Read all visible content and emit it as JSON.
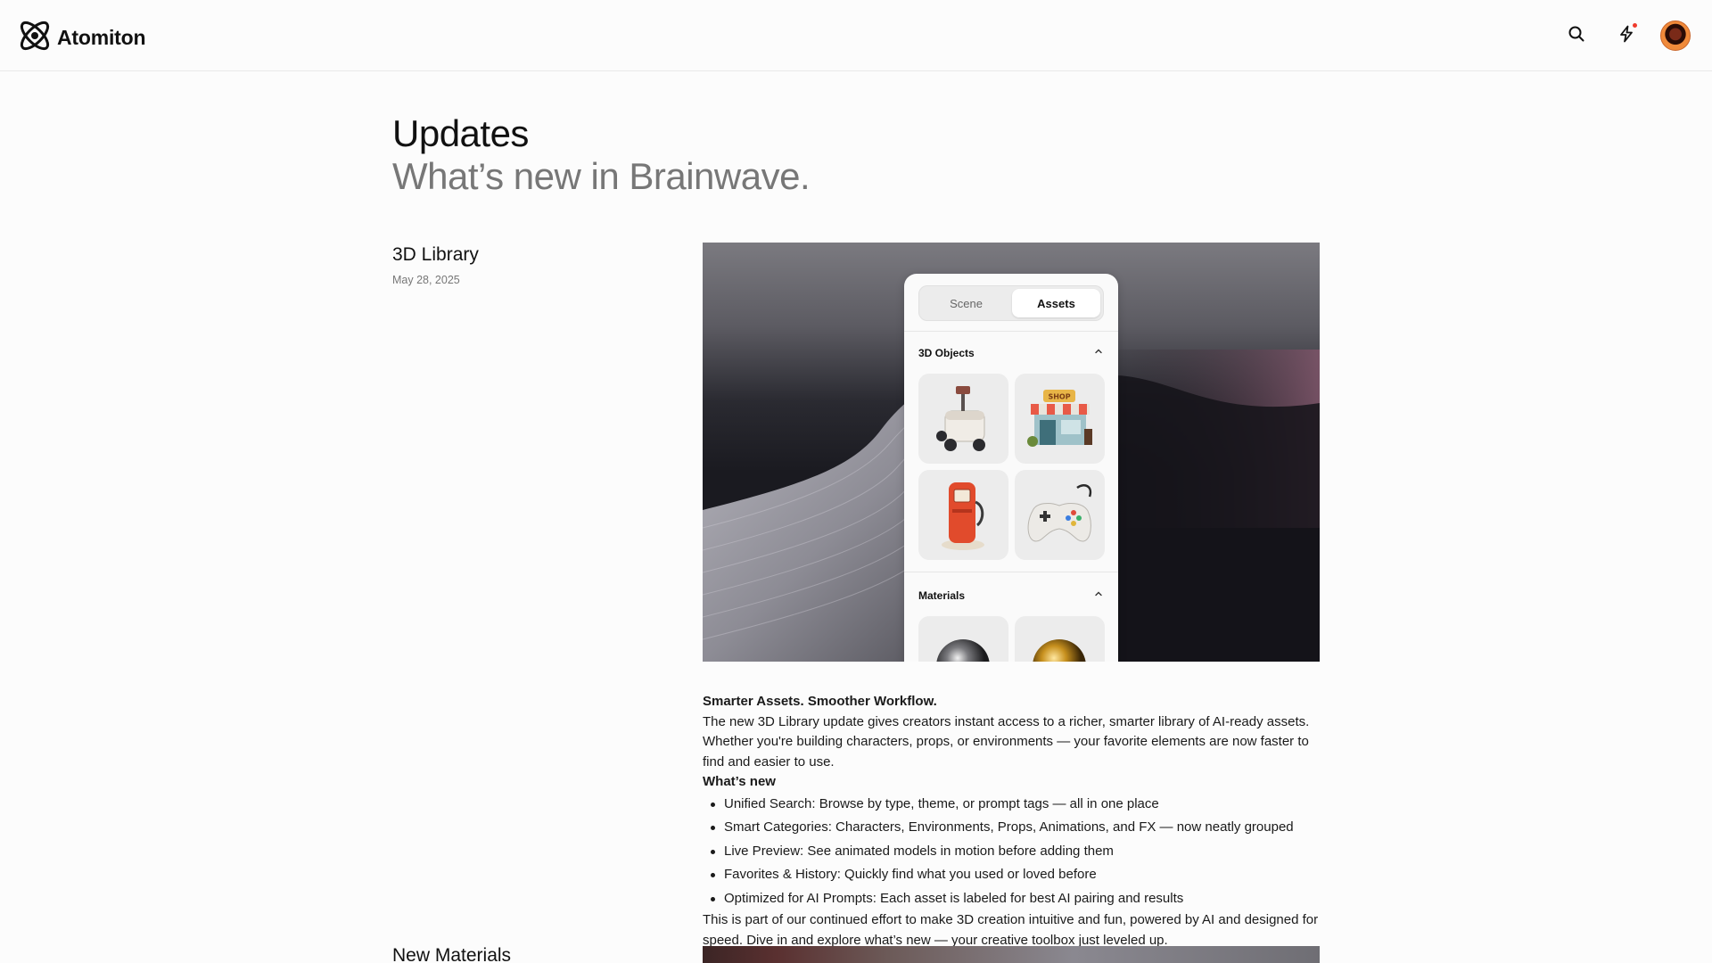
{
  "header": {
    "brand_name": "Atomiton",
    "logo_icon": "atom-logo-icon",
    "search_icon": "search-icon",
    "bolt_icon": "lightning-bolt-icon",
    "notification_dot_color": "#ef3b2d"
  },
  "hero": {
    "title": "Updates",
    "subtitle": "What’s new in Brainwave."
  },
  "entries": [
    {
      "title": "3D Library",
      "date": "May 28, 2025",
      "panel": {
        "tabs": [
          "Scene",
          "Assets"
        ],
        "active_tab": "Assets",
        "sections": [
          {
            "label": "3D Objects",
            "items": [
              "delivery-robot-icon",
              "shop-icon",
              "fuel-pump-icon",
              "game-controller-icon"
            ]
          },
          {
            "label": "Materials",
            "items": [
              "chrome-sphere-icon",
              "gold-sphere-icon"
            ]
          }
        ]
      },
      "lead": "Smarter Assets. Smoother Workflow.",
      "intro": "The new 3D Library update gives creators instant access to a richer, smarter library of AI-ready assets. Whether you're building characters, props, or environments — your favorite elements are now faster to find and easier to use.",
      "whats_new_heading": "What’s new",
      "bullets": [
        "Unified Search: Browse by type, theme, or prompt tags — all in one place",
        "Smart Categories: Characters, Environments, Props, Animations, and FX — now neatly grouped",
        "Live Preview: See animated models in motion before adding them",
        "Favorites & History: Quickly find what you used or loved before",
        "Optimized for AI Prompts: Each asset is labeled for best AI pairing and results"
      ],
      "outro": "This is part of our continued effort to make 3D creation intuitive and fun, powered by AI and designed for speed. Dive in and explore what’s new — your creative toolbox just leveled up."
    },
    {
      "title": "New Materials"
    }
  ]
}
